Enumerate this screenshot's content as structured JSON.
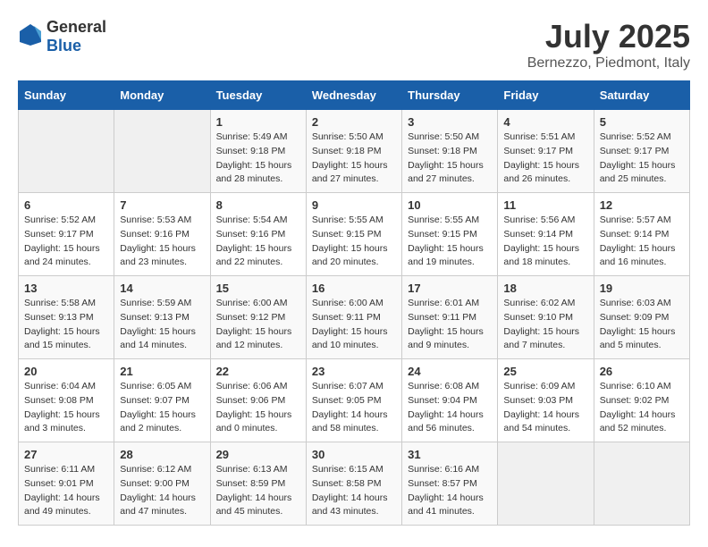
{
  "logo": {
    "text_general": "General",
    "text_blue": "Blue"
  },
  "title": {
    "month_year": "July 2025",
    "location": "Bernezzo, Piedmont, Italy"
  },
  "headers": [
    "Sunday",
    "Monday",
    "Tuesday",
    "Wednesday",
    "Thursday",
    "Friday",
    "Saturday"
  ],
  "weeks": [
    [
      {
        "day": "",
        "sunrise": "",
        "sunset": "",
        "daylight": ""
      },
      {
        "day": "",
        "sunrise": "",
        "sunset": "",
        "daylight": ""
      },
      {
        "day": "1",
        "sunrise": "Sunrise: 5:49 AM",
        "sunset": "Sunset: 9:18 PM",
        "daylight": "Daylight: 15 hours and 28 minutes."
      },
      {
        "day": "2",
        "sunrise": "Sunrise: 5:50 AM",
        "sunset": "Sunset: 9:18 PM",
        "daylight": "Daylight: 15 hours and 27 minutes."
      },
      {
        "day": "3",
        "sunrise": "Sunrise: 5:50 AM",
        "sunset": "Sunset: 9:18 PM",
        "daylight": "Daylight: 15 hours and 27 minutes."
      },
      {
        "day": "4",
        "sunrise": "Sunrise: 5:51 AM",
        "sunset": "Sunset: 9:17 PM",
        "daylight": "Daylight: 15 hours and 26 minutes."
      },
      {
        "day": "5",
        "sunrise": "Sunrise: 5:52 AM",
        "sunset": "Sunset: 9:17 PM",
        "daylight": "Daylight: 15 hours and 25 minutes."
      }
    ],
    [
      {
        "day": "6",
        "sunrise": "Sunrise: 5:52 AM",
        "sunset": "Sunset: 9:17 PM",
        "daylight": "Daylight: 15 hours and 24 minutes."
      },
      {
        "day": "7",
        "sunrise": "Sunrise: 5:53 AM",
        "sunset": "Sunset: 9:16 PM",
        "daylight": "Daylight: 15 hours and 23 minutes."
      },
      {
        "day": "8",
        "sunrise": "Sunrise: 5:54 AM",
        "sunset": "Sunset: 9:16 PM",
        "daylight": "Daylight: 15 hours and 22 minutes."
      },
      {
        "day": "9",
        "sunrise": "Sunrise: 5:55 AM",
        "sunset": "Sunset: 9:15 PM",
        "daylight": "Daylight: 15 hours and 20 minutes."
      },
      {
        "day": "10",
        "sunrise": "Sunrise: 5:55 AM",
        "sunset": "Sunset: 9:15 PM",
        "daylight": "Daylight: 15 hours and 19 minutes."
      },
      {
        "day": "11",
        "sunrise": "Sunrise: 5:56 AM",
        "sunset": "Sunset: 9:14 PM",
        "daylight": "Daylight: 15 hours and 18 minutes."
      },
      {
        "day": "12",
        "sunrise": "Sunrise: 5:57 AM",
        "sunset": "Sunset: 9:14 PM",
        "daylight": "Daylight: 15 hours and 16 minutes."
      }
    ],
    [
      {
        "day": "13",
        "sunrise": "Sunrise: 5:58 AM",
        "sunset": "Sunset: 9:13 PM",
        "daylight": "Daylight: 15 hours and 15 minutes."
      },
      {
        "day": "14",
        "sunrise": "Sunrise: 5:59 AM",
        "sunset": "Sunset: 9:13 PM",
        "daylight": "Daylight: 15 hours and 14 minutes."
      },
      {
        "day": "15",
        "sunrise": "Sunrise: 6:00 AM",
        "sunset": "Sunset: 9:12 PM",
        "daylight": "Daylight: 15 hours and 12 minutes."
      },
      {
        "day": "16",
        "sunrise": "Sunrise: 6:00 AM",
        "sunset": "Sunset: 9:11 PM",
        "daylight": "Daylight: 15 hours and 10 minutes."
      },
      {
        "day": "17",
        "sunrise": "Sunrise: 6:01 AM",
        "sunset": "Sunset: 9:11 PM",
        "daylight": "Daylight: 15 hours and 9 minutes."
      },
      {
        "day": "18",
        "sunrise": "Sunrise: 6:02 AM",
        "sunset": "Sunset: 9:10 PM",
        "daylight": "Daylight: 15 hours and 7 minutes."
      },
      {
        "day": "19",
        "sunrise": "Sunrise: 6:03 AM",
        "sunset": "Sunset: 9:09 PM",
        "daylight": "Daylight: 15 hours and 5 minutes."
      }
    ],
    [
      {
        "day": "20",
        "sunrise": "Sunrise: 6:04 AM",
        "sunset": "Sunset: 9:08 PM",
        "daylight": "Daylight: 15 hours and 3 minutes."
      },
      {
        "day": "21",
        "sunrise": "Sunrise: 6:05 AM",
        "sunset": "Sunset: 9:07 PM",
        "daylight": "Daylight: 15 hours and 2 minutes."
      },
      {
        "day": "22",
        "sunrise": "Sunrise: 6:06 AM",
        "sunset": "Sunset: 9:06 PM",
        "daylight": "Daylight: 15 hours and 0 minutes."
      },
      {
        "day": "23",
        "sunrise": "Sunrise: 6:07 AM",
        "sunset": "Sunset: 9:05 PM",
        "daylight": "Daylight: 14 hours and 58 minutes."
      },
      {
        "day": "24",
        "sunrise": "Sunrise: 6:08 AM",
        "sunset": "Sunset: 9:04 PM",
        "daylight": "Daylight: 14 hours and 56 minutes."
      },
      {
        "day": "25",
        "sunrise": "Sunrise: 6:09 AM",
        "sunset": "Sunset: 9:03 PM",
        "daylight": "Daylight: 14 hours and 54 minutes."
      },
      {
        "day": "26",
        "sunrise": "Sunrise: 6:10 AM",
        "sunset": "Sunset: 9:02 PM",
        "daylight": "Daylight: 14 hours and 52 minutes."
      }
    ],
    [
      {
        "day": "27",
        "sunrise": "Sunrise: 6:11 AM",
        "sunset": "Sunset: 9:01 PM",
        "daylight": "Daylight: 14 hours and 49 minutes."
      },
      {
        "day": "28",
        "sunrise": "Sunrise: 6:12 AM",
        "sunset": "Sunset: 9:00 PM",
        "daylight": "Daylight: 14 hours and 47 minutes."
      },
      {
        "day": "29",
        "sunrise": "Sunrise: 6:13 AM",
        "sunset": "Sunset: 8:59 PM",
        "daylight": "Daylight: 14 hours and 45 minutes."
      },
      {
        "day": "30",
        "sunrise": "Sunrise: 6:15 AM",
        "sunset": "Sunset: 8:58 PM",
        "daylight": "Daylight: 14 hours and 43 minutes."
      },
      {
        "day": "31",
        "sunrise": "Sunrise: 6:16 AM",
        "sunset": "Sunset: 8:57 PM",
        "daylight": "Daylight: 14 hours and 41 minutes."
      },
      {
        "day": "",
        "sunrise": "",
        "sunset": "",
        "daylight": ""
      },
      {
        "day": "",
        "sunrise": "",
        "sunset": "",
        "daylight": ""
      }
    ]
  ]
}
